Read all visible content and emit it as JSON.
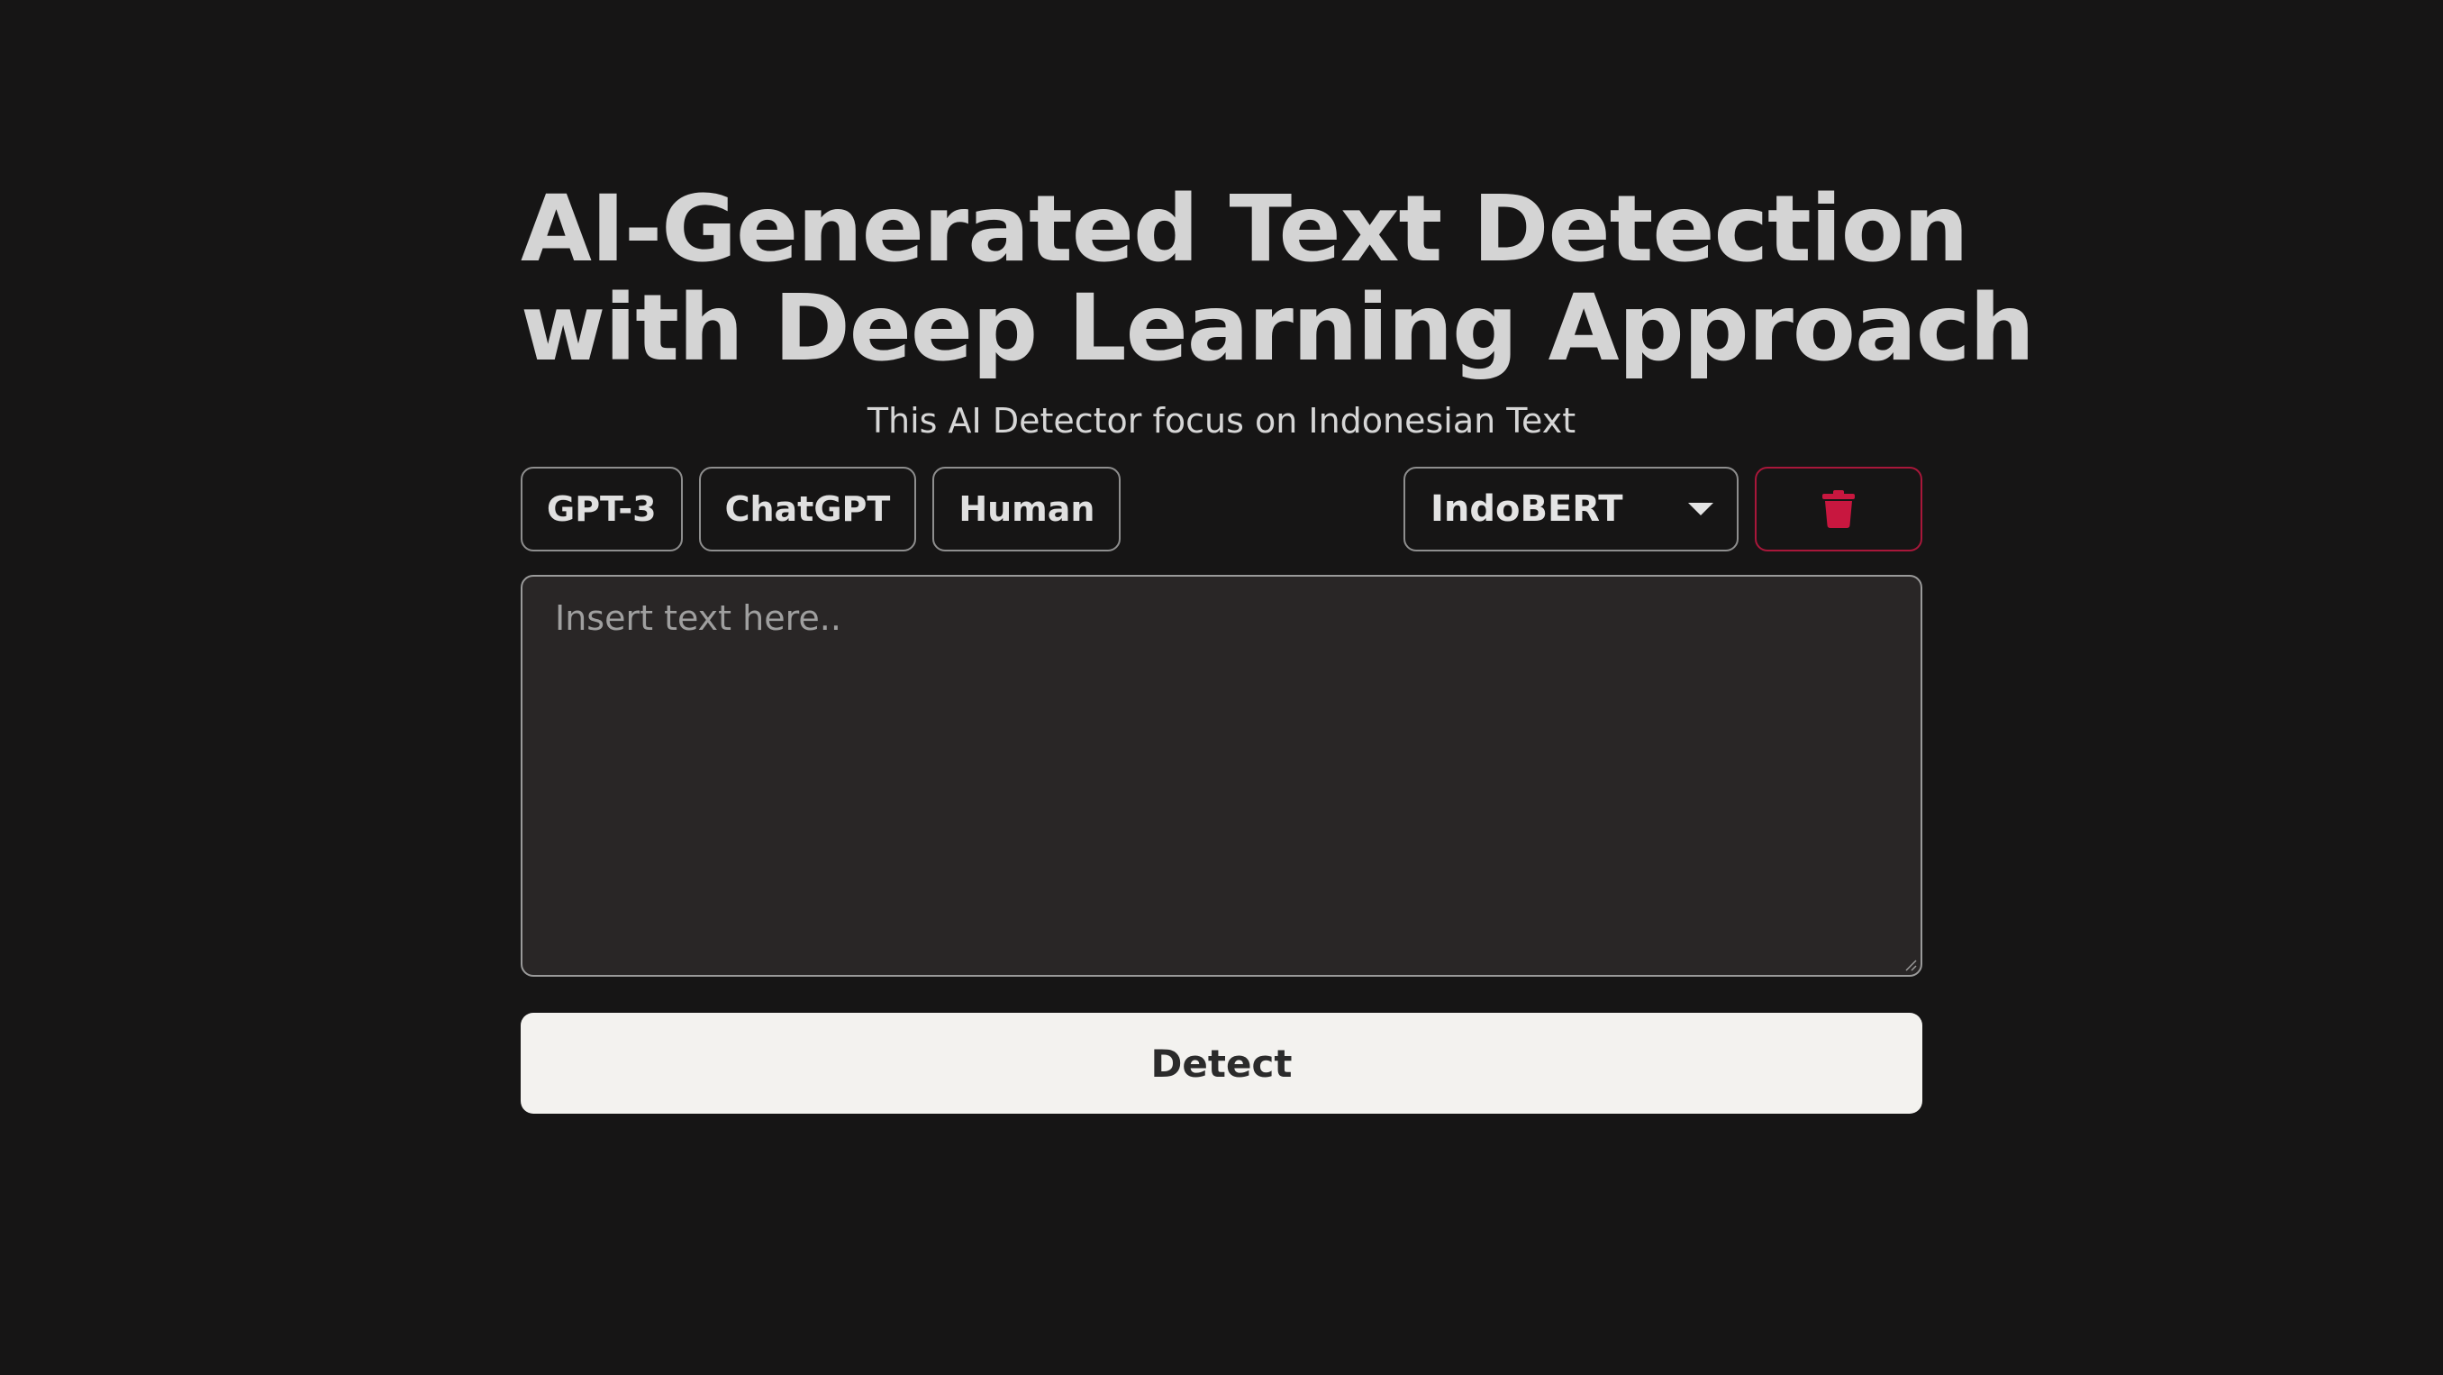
{
  "header": {
    "title_line1": "AI-Generated Text Detection",
    "title_line2": "with Deep Learning Approach",
    "subtitle": "This AI Detector focus on Indonesian Text"
  },
  "sample_buttons": [
    {
      "label": "GPT-3"
    },
    {
      "label": "ChatGPT"
    },
    {
      "label": "Human"
    }
  ],
  "model_select": {
    "selected": "IndoBERT",
    "icon": "chevron-down-icon"
  },
  "clear_button": {
    "icon": "trash-icon",
    "color": "#c8173f"
  },
  "text_input": {
    "value": "",
    "placeholder": "Insert text here.."
  },
  "detect_button": {
    "label": "Detect"
  },
  "colors": {
    "background": "#161515",
    "accent_danger": "#c8173f",
    "primary_button": "#f3f2ef"
  }
}
